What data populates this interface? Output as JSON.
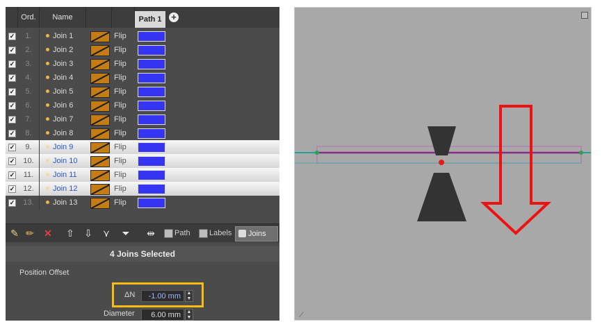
{
  "columns": {
    "ord": "Ord.",
    "name": "Name",
    "path_tab": "Path 1",
    "add": "+"
  },
  "rows": [
    {
      "check": "✓",
      "ord": "1.",
      "name": "Join 1",
      "flip": "Flip",
      "selected": false
    },
    {
      "check": "✓",
      "ord": "2.",
      "name": "Join 2",
      "flip": "Flip",
      "selected": false
    },
    {
      "check": "✓",
      "ord": "3.",
      "name": "Join 3",
      "flip": "Flip",
      "selected": false
    },
    {
      "check": "✓",
      "ord": "4.",
      "name": "Join 4",
      "flip": "Flip",
      "selected": false
    },
    {
      "check": "✓",
      "ord": "5.",
      "name": "Join 5",
      "flip": "Flip",
      "selected": false
    },
    {
      "check": "✓",
      "ord": "6.",
      "name": "Join 6",
      "flip": "Flip",
      "selected": false
    },
    {
      "check": "✓",
      "ord": "7.",
      "name": "Join 7",
      "flip": "Flip",
      "selected": false
    },
    {
      "check": "✓",
      "ord": "8.",
      "name": "Join 8",
      "flip": "Flip",
      "selected": false
    },
    {
      "check": "✓",
      "ord": "9.",
      "name": "Join 9",
      "flip": "Flip",
      "selected": true
    },
    {
      "check": "✓",
      "ord": "10.",
      "name": "Join 10",
      "flip": "Flip",
      "selected": true
    },
    {
      "check": "✓",
      "ord": "11.",
      "name": "Join 11",
      "flip": "Flip",
      "selected": true
    },
    {
      "check": "✓",
      "ord": "12.",
      "name": "Join 12",
      "flip": "Flip",
      "selected": true
    },
    {
      "check": "✓",
      "ord": "13.",
      "name": "Join 13",
      "flip": "Flip",
      "selected": false
    }
  ],
  "toolbar": {
    "path_label": "Path",
    "labels_label": "Labels",
    "joins_label": "Joins",
    "icons": [
      "wand-icon",
      "pencil-icon",
      "delete-icon",
      "arrow-up-icon",
      "arrow-down-icon",
      "split-icon",
      "filter-icon",
      "align-icon"
    ]
  },
  "selection_bar": "4 Joins Selected",
  "properties": {
    "section_title": "Position Offset",
    "delta_n_label": "ΔN",
    "delta_n_value": "-1.00 mm",
    "diameter_label": "Diameter",
    "diameter_value": "6.00 mm"
  },
  "colors": {
    "join_color": "#3535f2",
    "swatch": "#c57c14",
    "highlight": "#f7bd13",
    "arrow": "#ee1111",
    "path_purple": "#8a2b8a",
    "path_teal": "#1aa39a",
    "marker": "#e61b1b"
  }
}
